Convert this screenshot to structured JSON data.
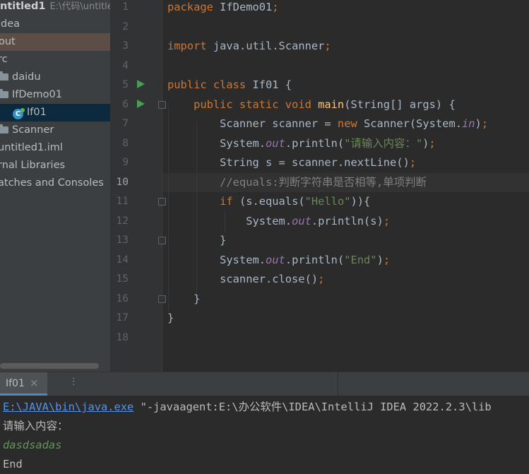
{
  "project_tree": {
    "rows": [
      {
        "label": "ntitled1",
        "path": "E:\\代码\\untitled"
      },
      {
        "label": "idea"
      },
      {
        "label": "out"
      },
      {
        "label": "rc"
      },
      {
        "label": "daidu"
      },
      {
        "label": "IfDemo01"
      },
      {
        "label": "If01"
      },
      {
        "label": "Scanner"
      },
      {
        "label": "untitled1.iml"
      },
      {
        "label": "rnal Libraries"
      },
      {
        "label": "atches and Consoles"
      }
    ],
    "class_icon_letter": "C"
  },
  "editor": {
    "line_numbers": [
      "1",
      "2",
      "3",
      "4",
      "5",
      "6",
      "7",
      "8",
      "9",
      "10",
      "11",
      "12",
      "13",
      "14",
      "15",
      "16",
      "17",
      "18"
    ],
    "current_line": 10,
    "lines": [
      [
        {
          "t": "package ",
          "c": "kw"
        },
        {
          "t": "IfDemo01",
          "c": ""
        },
        {
          "t": ";",
          "c": "kw"
        }
      ],
      [],
      [
        {
          "t": "import ",
          "c": "kw"
        },
        {
          "t": "java.util.Scanner",
          "c": ""
        },
        {
          "t": ";",
          "c": "kw"
        }
      ],
      [],
      [
        {
          "t": "public class ",
          "c": "kw"
        },
        {
          "t": "If01 {",
          "c": ""
        }
      ],
      [
        {
          "t": "    public static void ",
          "c": "kw"
        },
        {
          "t": "main",
          "c": "fn"
        },
        {
          "t": "(String[] args) {",
          "c": ""
        }
      ],
      [
        {
          "t": "        Scanner scanner = ",
          "c": ""
        },
        {
          "t": "new ",
          "c": "kw"
        },
        {
          "t": "Scanner(System.",
          "c": ""
        },
        {
          "t": "in",
          "c": "fld"
        },
        {
          "t": ")",
          "c": ""
        },
        {
          "t": ";",
          "c": "kw"
        }
      ],
      [
        {
          "t": "        System.",
          "c": ""
        },
        {
          "t": "out",
          "c": "fld"
        },
        {
          "t": ".println(",
          "c": ""
        },
        {
          "t": "\"请输入内容：\"",
          "c": "str"
        },
        {
          "t": ")",
          "c": ""
        },
        {
          "t": ";",
          "c": "kw"
        }
      ],
      [
        {
          "t": "        String s = scanner.nextLine()",
          "c": ""
        },
        {
          "t": ";",
          "c": "kw"
        }
      ],
      [
        {
          "t": "        //equals:判断字符串是否相等,单项判断",
          "c": "cmt"
        }
      ],
      [
        {
          "t": "        if ",
          "c": "kw"
        },
        {
          "t": "(s.equals(",
          "c": ""
        },
        {
          "t": "\"Hello\"",
          "c": "str"
        },
        {
          "t": ")){",
          "c": ""
        }
      ],
      [
        {
          "t": "            System.",
          "c": ""
        },
        {
          "t": "out",
          "c": "fld"
        },
        {
          "t": ".println(s)",
          "c": ""
        },
        {
          "t": ";",
          "c": "kw"
        }
      ],
      [
        {
          "t": "        }",
          "c": ""
        }
      ],
      [
        {
          "t": "        System.",
          "c": ""
        },
        {
          "t": "out",
          "c": "fld"
        },
        {
          "t": ".println(",
          "c": ""
        },
        {
          "t": "\"End\"",
          "c": "str"
        },
        {
          "t": ")",
          "c": ""
        },
        {
          "t": ";",
          "c": "kw"
        }
      ],
      [
        {
          "t": "        scanner.close()",
          "c": ""
        },
        {
          "t": ";",
          "c": "kw"
        }
      ],
      [
        {
          "t": "    }",
          "c": ""
        }
      ],
      [
        {
          "t": "}",
          "c": ""
        }
      ],
      []
    ]
  },
  "run_panel": {
    "tab_label": "If01",
    "close_glyph": "×",
    "settings_glyph": "⋮",
    "console": {
      "java_path": "E:\\JAVA\\bin\\java.exe",
      "command_rest": " \"-javaagent:E:\\办公软件\\IDEA\\IntelliJ IDEA 2022.2.3\\lib",
      "prompt": "请输入内容：",
      "user_input": "dasdsadas",
      "output": "End"
    }
  },
  "colors": {
    "keyword": "#cc7832",
    "method": "#ffc66d",
    "string": "#6a8759",
    "static_field": "#9876aa",
    "comment": "#808080",
    "run_icon": "#499c54",
    "selection": "#0d293e"
  }
}
